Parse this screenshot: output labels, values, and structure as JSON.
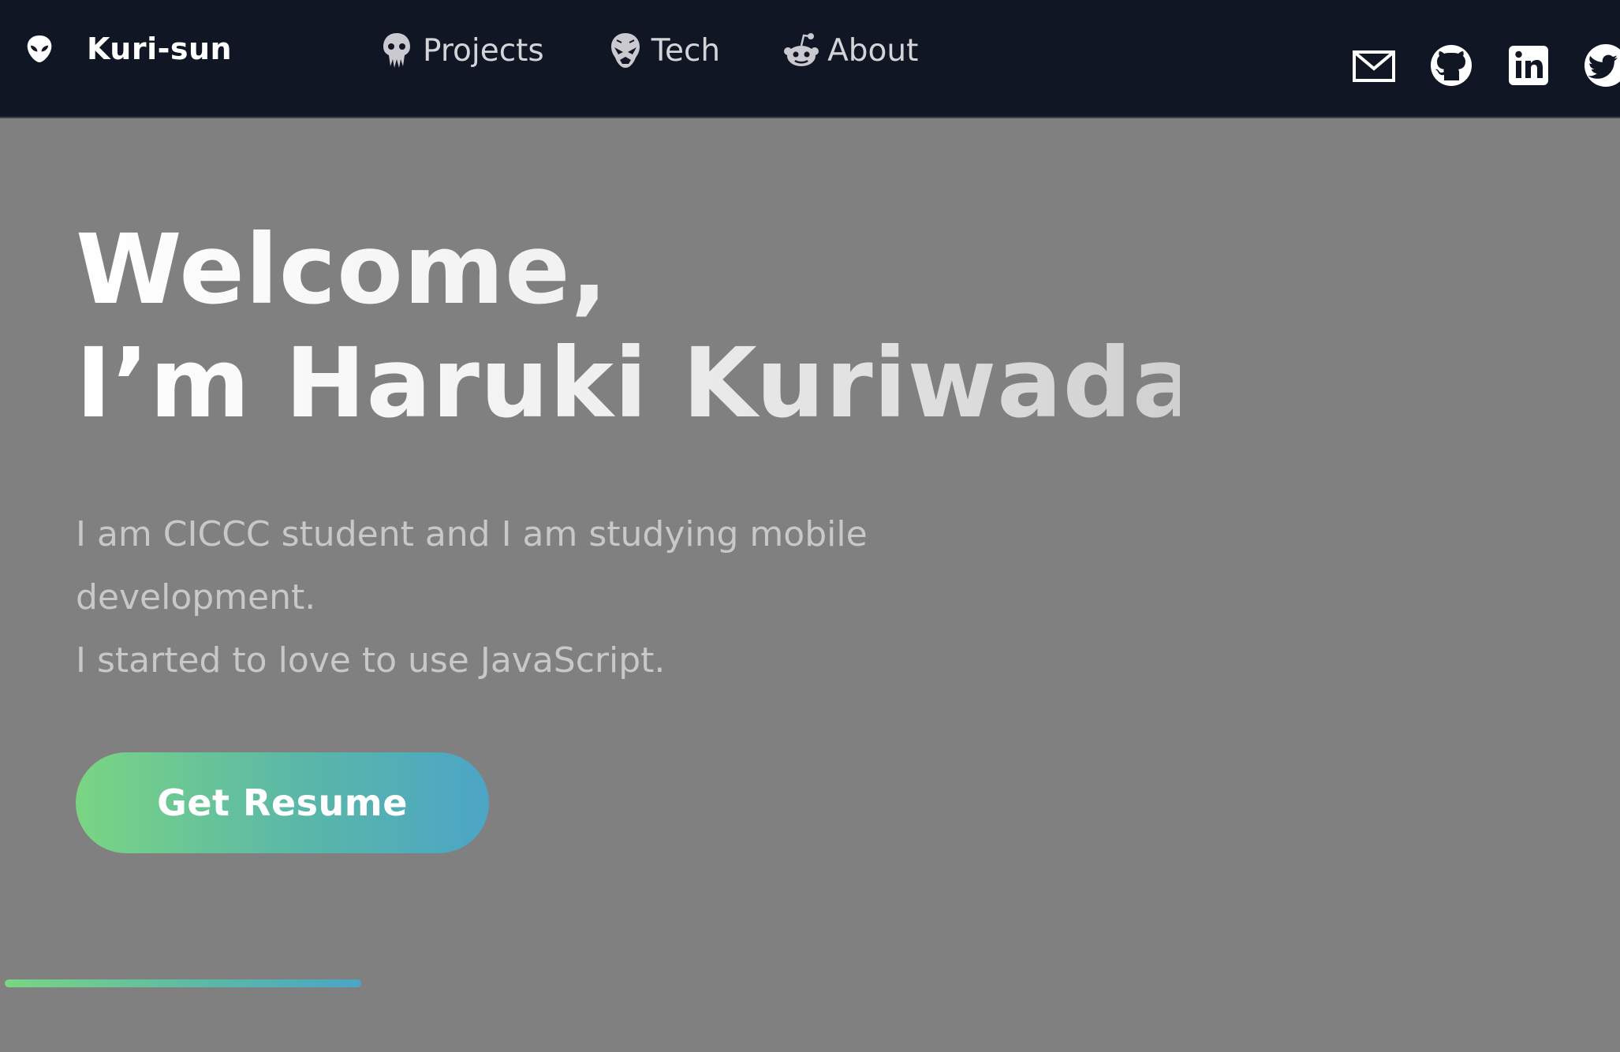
{
  "navbar": {
    "brand": {
      "icon": "alien-head-icon",
      "name": "Kuri-sun"
    },
    "links": [
      {
        "icon": "squid-skull-icon",
        "label": "Projects"
      },
      {
        "icon": "alien-face-icon",
        "label": "Tech"
      },
      {
        "icon": "reddit-alien-icon",
        "label": "About"
      }
    ],
    "social": [
      {
        "icon": "mail-icon"
      },
      {
        "icon": "github-icon"
      },
      {
        "icon": "linkedin-icon"
      },
      {
        "icon": "twitter-icon"
      }
    ]
  },
  "hero": {
    "title_line1": "Welcome,",
    "title_line2": "I’m Haruki Kuriwada.",
    "desc_line1": "I am CICCC student and I am studying mobile",
    "desc_line2": "development.",
    "desc_line3": "I started to love to use JavaScript.",
    "button_label": "Get Resume"
  },
  "scroll_progress": 0.22,
  "colors": {
    "navbar_bg": "#101624",
    "page_bg": "#808080",
    "gradient_start": "#7ad583",
    "gradient_end": "#4ba5c6"
  }
}
